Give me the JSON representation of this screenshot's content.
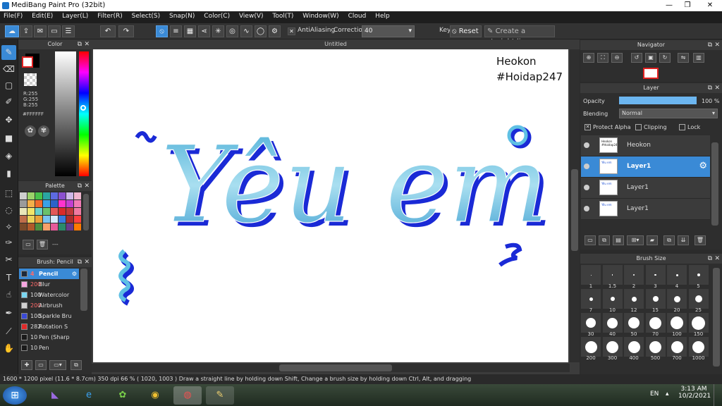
{
  "window": {
    "title": "MediBang Paint Pro (32bit)",
    "minimize": "—",
    "maximize": "❐",
    "close": "✕"
  },
  "menu": [
    "File(F)",
    "Edit(E)",
    "Layer(L)",
    "Filter(R)",
    "Select(S)",
    "Snap(N)",
    "Color(C)",
    "View(V)",
    "Tool(T)",
    "Window(W)",
    "Cloud",
    "Help"
  ],
  "toolbar": {
    "antialiasing_label": "AntiAliasing",
    "correction_label": "Correction",
    "correction_value": "40",
    "key_label": "Key",
    "reset_label": "Reset",
    "straight_line_label": "Create a straight line"
  },
  "color_panel": {
    "title": "Color",
    "r": "R:255",
    "g": "G:255",
    "b": "B:255",
    "hex": "#FFFFFF",
    "foreground": "#ffffff",
    "background": "#000000"
  },
  "palette": {
    "title": "Palette",
    "more": "---",
    "colors": [
      "#cfcfcf",
      "#9bd36a",
      "#49c24a",
      "#2aa5a2",
      "#5d6ae0",
      "#8a4fcf",
      "#cdb7e8",
      "#f0b6cf",
      "#9b9b9b",
      "#f3b04a",
      "#ef6b2c",
      "#3aa1e6",
      "#2b63c9",
      "#ff33cc",
      "#c23fd1",
      "#f27ab6",
      "#e9e6b9",
      "#f1e56a",
      "#6bd0c7",
      "#6ac26b",
      "#e35858",
      "#d92a2a",
      "#c23a3a",
      "#f07aa3",
      "#c06d4a",
      "#ebd35a",
      "#e8a13a",
      "#7ac4f0",
      "#d7eafa",
      "#3a7adf",
      "#a82d2d",
      "#ff4040",
      "#7a4a2a",
      "#b05a2a",
      "#4e8e3e",
      "#f7a06a",
      "#e55a9a",
      "#2a8a6a",
      "#6a3a8a",
      "#ff7a00"
    ]
  },
  "brush_panel": {
    "title": "Brush: Pencil",
    "items": [
      {
        "size": "4",
        "name": "Pencil",
        "color": "#1e2a3a"
      },
      {
        "size": "200",
        "name": "Blur",
        "color": "#f7a6e0"
      },
      {
        "size": "100",
        "name": "Watercolor",
        "color": "#7ad6f0"
      },
      {
        "size": "200",
        "name": "Airbrush",
        "color": "#d0d0d0"
      },
      {
        "size": "100",
        "name": "Sparkle Bru",
        "color": "#3a4ad6"
      },
      {
        "size": "282",
        "name": "Rotation S",
        "color": "#e02a2a"
      },
      {
        "size": "10",
        "name": "Pen (Sharp",
        "color": "#1a1a1a"
      },
      {
        "size": "10",
        "name": "Pen",
        "color": "#1a1a1a"
      }
    ]
  },
  "canvas": {
    "tab_title": "Untitled",
    "watermark_line1": "Heokon",
    "watermark_line2": "#Hoidap247",
    "art_text": "Yêu em"
  },
  "navigator": {
    "title": "Navigator"
  },
  "layer_panel": {
    "title": "Layer",
    "opacity_label": "Opacity",
    "opacity_value": "100 %",
    "opacity_fraction": 1.0,
    "blending_label": "Blending",
    "blending_value": "Normal",
    "protect_alpha": "Protect Alpha",
    "clipping": "Clipping",
    "lock": "Lock",
    "layers": [
      {
        "name": "Heokon",
        "thumb": "Heokon #Hoidap247",
        "selected": false
      },
      {
        "name": "Layer1",
        "thumb": "Yêu em",
        "selected": true
      },
      {
        "name": "Layer1",
        "thumb": "Yêu em",
        "selected": false
      },
      {
        "name": "Layer1",
        "thumb": "Yêu em",
        "selected": false
      }
    ]
  },
  "brush_size": {
    "title": "Brush Size",
    "sizes": [
      "1",
      "1.5",
      "2",
      "3",
      "4",
      "5",
      "7",
      "10",
      "12",
      "15",
      "20",
      "25",
      "30",
      "40",
      "50",
      "70",
      "100",
      "150",
      "200",
      "300",
      "400",
      "500",
      "700",
      "1000"
    ]
  },
  "status": {
    "text": "1600 * 1200 pixel   (11.6 * 8.7cm)   350 dpi   66 %   ( 1020, 1003 )   Draw a straight line by holding down Shift, Change a brush size by holding down Ctrl, Alt, and dragging"
  },
  "taskbar": {
    "lang": "EN",
    "time": "3:13 AM",
    "date": "10/2/2021"
  }
}
